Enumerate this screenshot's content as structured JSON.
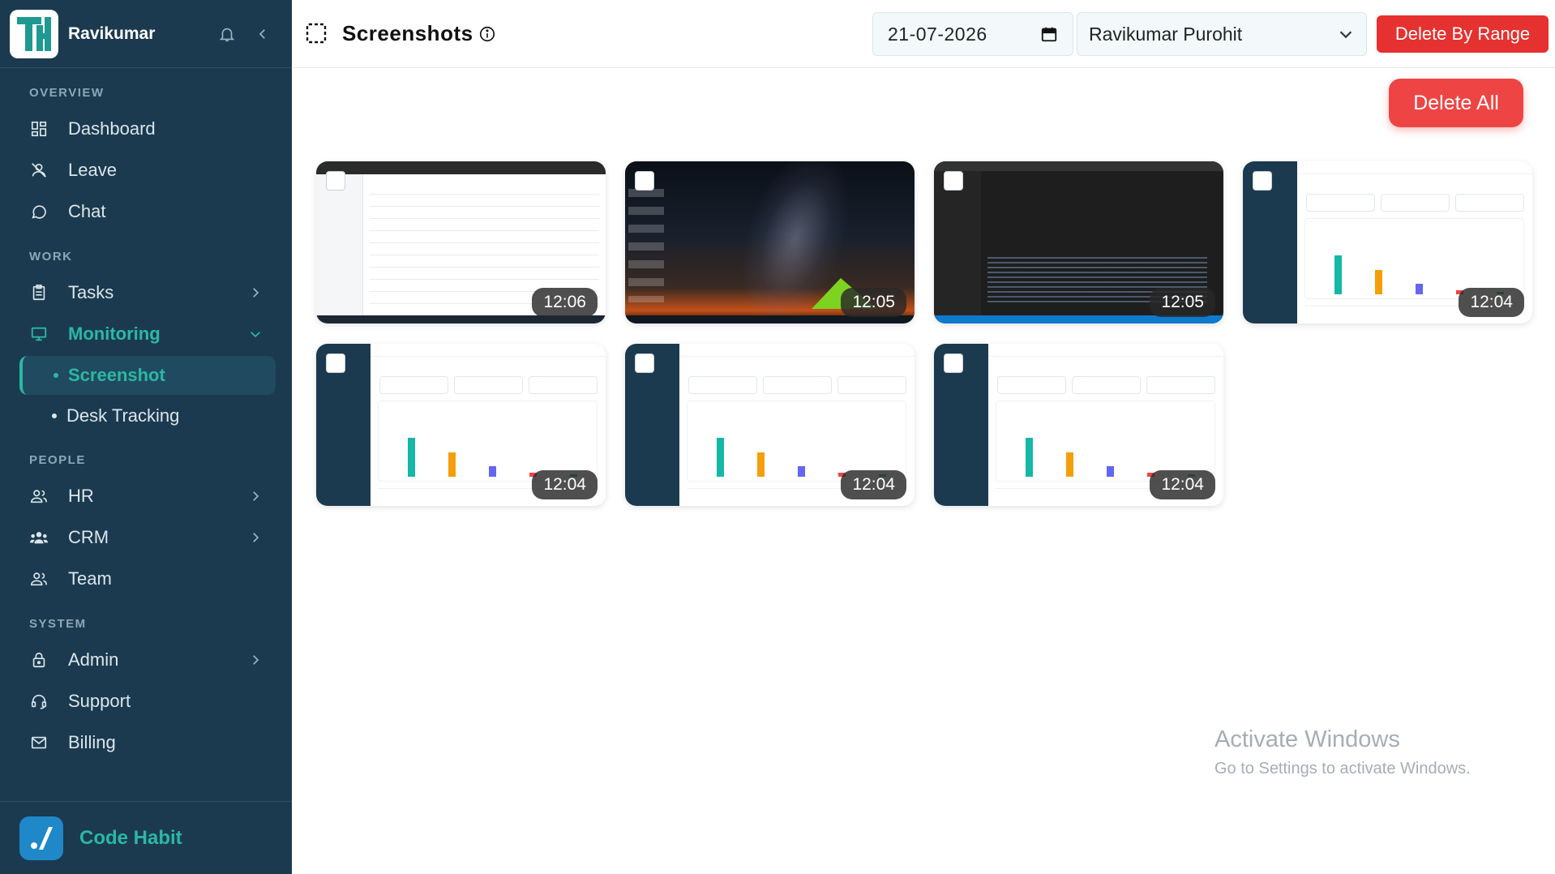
{
  "sidebar": {
    "brand_name": "Ravikumar",
    "sections": {
      "overview": "OVERVIEW",
      "work": "WORK",
      "people": "PEOPLE",
      "system": "SYSTEM"
    },
    "items": {
      "dashboard": "Dashboard",
      "leave": "Leave",
      "chat": "Chat",
      "tasks": "Tasks",
      "monitoring": "Monitoring",
      "screenshot": "Screenshot",
      "desk_tracking": "Desk Tracking",
      "hr": "HR",
      "crm": "CRM",
      "team": "Team",
      "admin": "Admin",
      "support": "Support",
      "billing": "Billing"
    },
    "footer_name": "Code Habit"
  },
  "header": {
    "title": "Screenshots",
    "date_value": "21-07-2026",
    "user_value": "Ravikumar Purohit",
    "delete_range_label": "Delete By Range"
  },
  "main": {
    "delete_all_label": "Delete All",
    "screenshots": [
      {
        "time": "12:06"
      },
      {
        "time": "12:05"
      },
      {
        "time": "12:05"
      },
      {
        "time": "12:04"
      },
      {
        "time": "12:04"
      },
      {
        "time": "12:04"
      },
      {
        "time": "12:04"
      }
    ]
  },
  "watermark": {
    "line1": "Activate Windows",
    "line2": "Go to Settings to activate Windows."
  },
  "colors": {
    "sidebar_bg": "#1b3a4f",
    "accent": "#2bb8a3",
    "danger": "#e5312f"
  }
}
